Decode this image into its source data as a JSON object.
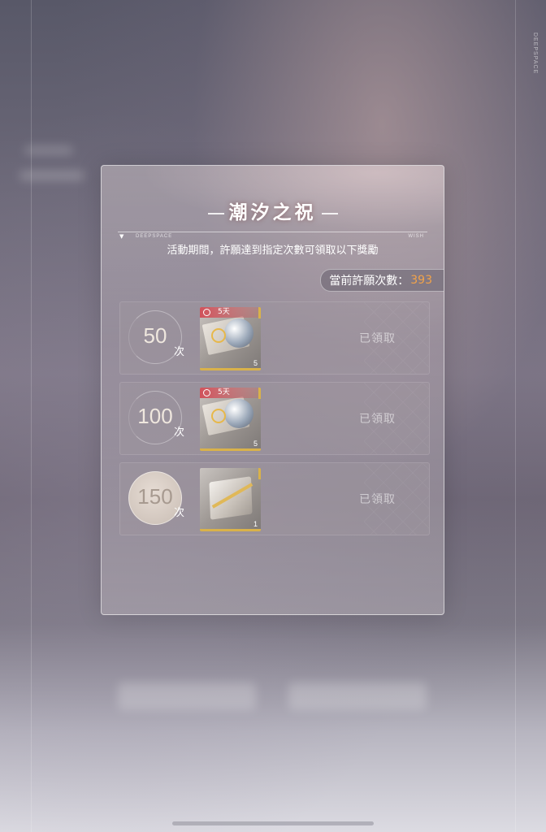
{
  "background": {
    "side_text": "DEEPSPACE"
  },
  "panel": {
    "title": "潮汐之祝",
    "tag_left": "DEEPSPACE",
    "tag_right": "WISH",
    "subtitle": "活動期間，許願達到指定次數可領取以下獎勵",
    "count_label": "當前許願次數：",
    "count_value": "393",
    "rewards": [
      {
        "threshold": "50",
        "unit": "次",
        "timer": "5天",
        "quantity": "5",
        "status": "已領取",
        "item_icon": "ticket-orb-icon"
      },
      {
        "threshold": "100",
        "unit": "次",
        "timer": "5天",
        "quantity": "5",
        "status": "已領取",
        "item_icon": "ticket-orb-icon"
      },
      {
        "threshold": "150",
        "unit": "次",
        "timer": "",
        "quantity": "1",
        "status": "已領取",
        "item_icon": "gift-box-icon"
      }
    ]
  },
  "colors": {
    "accent_count": "#f2a34a",
    "timer_red": "#d24650",
    "rarity_gold": "#d9b24a"
  }
}
